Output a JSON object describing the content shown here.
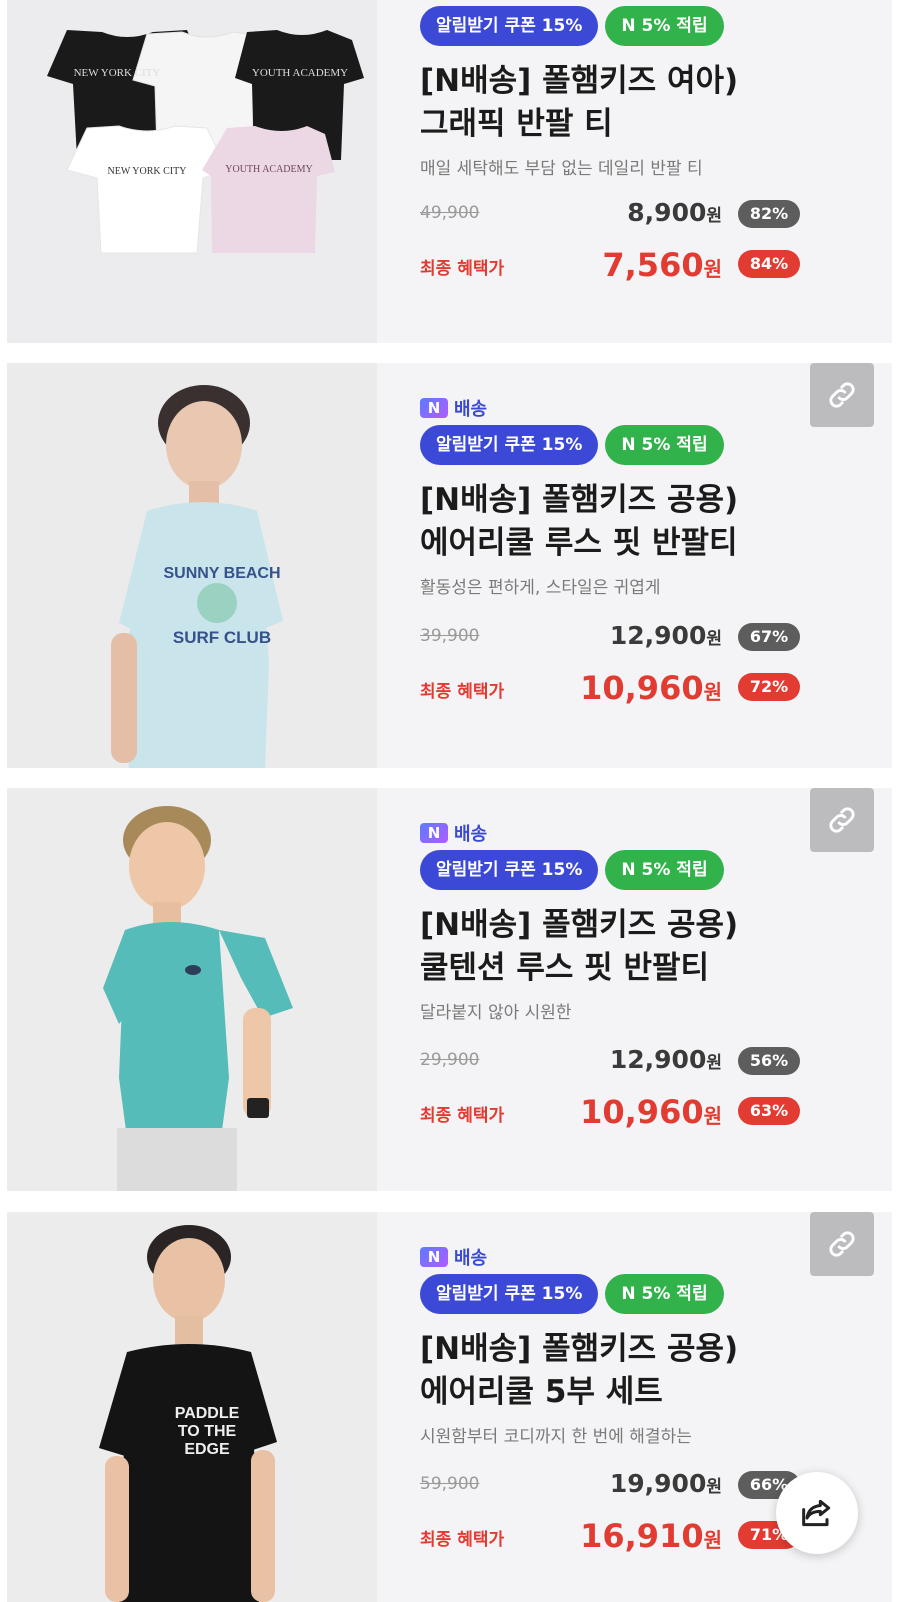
{
  "products": [
    {
      "shipping_label": "",
      "coupon": "알림받기 쿠폰 15%",
      "points": "N 5% 적립",
      "title_line1": "[N배송] 폴햄키즈 여아)",
      "title_line2": "그래픽 반팔 티",
      "desc": "매일 세탁해도 부담 없는 데일리 반팔 티",
      "original_price": "49,900",
      "price": "8,900",
      "price_unit": "원",
      "discount": "82%",
      "final_label": "최종 혜택가",
      "final_price": "7,560",
      "final_unit": "원",
      "final_discount": "84%",
      "image_texts": [
        "NEW YORK CITY",
        "YOUTH ACADEMY",
        "NEW YORK CITY",
        "YOUTH ACADEMY"
      ]
    },
    {
      "shipping_logo": "N",
      "shipping_label": "배송",
      "coupon": "알림받기 쿠폰 15%",
      "points": "N 5% 적립",
      "title_line1": "[N배송] 폴햄키즈 공용)",
      "title_line2": "에어리쿨 루스 핏 반팔티",
      "desc": "활동성은 편하게, 스타일은 귀엽게",
      "original_price": "39,900",
      "price": "12,900",
      "price_unit": "원",
      "discount": "67%",
      "final_label": "최종 혜택가",
      "final_price": "10,960",
      "final_unit": "원",
      "final_discount": "72%",
      "image_texts": [
        "SUNNY BEACH",
        "SURF CLUB"
      ]
    },
    {
      "shipping_logo": "N",
      "shipping_label": "배송",
      "coupon": "알림받기 쿠폰 15%",
      "points": "N 5% 적립",
      "title_line1": "[N배송] 폴햄키즈 공용)",
      "title_line2": "쿨텐션 루스 핏 반팔티",
      "desc": "달라붙지 않아 시원한",
      "original_price": "29,900",
      "price": "12,900",
      "price_unit": "원",
      "discount": "56%",
      "final_label": "최종 혜택가",
      "final_price": "10,960",
      "final_unit": "원",
      "final_discount": "63%"
    },
    {
      "shipping_logo": "N",
      "shipping_label": "배송",
      "coupon": "알림받기 쿠폰 15%",
      "points": "N 5% 적립",
      "title_line1": "[N배송] 폴햄키즈 공용)",
      "title_line2": "에어리쿨 5부 세트",
      "desc": "시원함부터 코디까지 한 번에 해결하는",
      "original_price": "59,900",
      "price": "19,900",
      "price_unit": "원",
      "discount": "66%",
      "final_label": "최종 혜택가",
      "final_price": "16,910",
      "final_unit": "원",
      "final_discount": "71%",
      "image_texts": [
        "PADDLE",
        "TO THE",
        "EDGE"
      ]
    }
  ],
  "colors": {
    "coupon_blue": "#3b49d6",
    "points_green": "#31b24a",
    "sale_red": "#e23b32",
    "card_bg": "#f4f4f6"
  },
  "icons": {
    "copy_link": "link-icon",
    "share": "share-icon"
  }
}
